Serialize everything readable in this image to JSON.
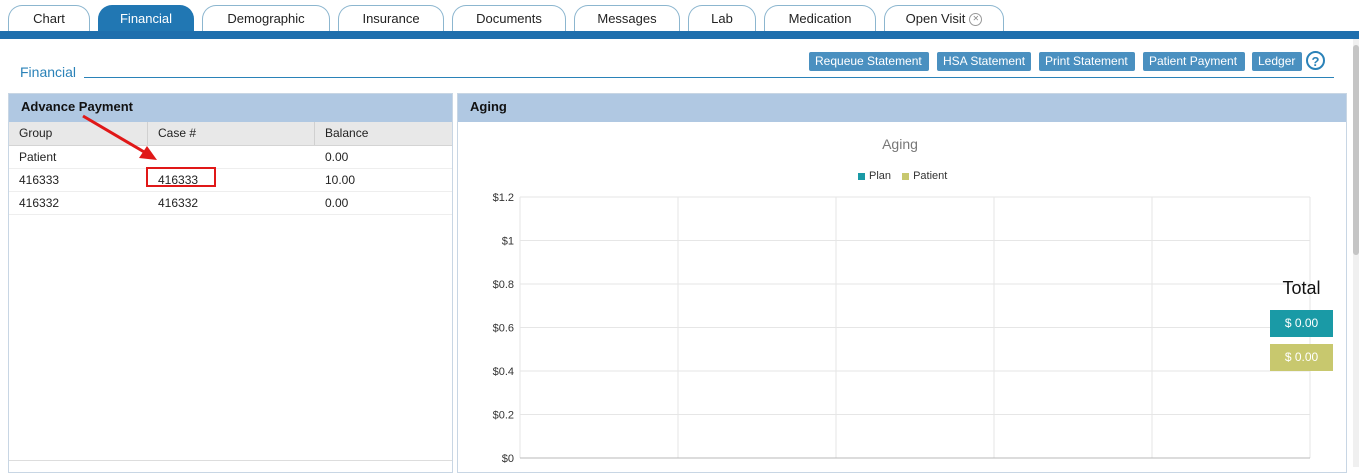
{
  "tabs": [
    {
      "label": "Chart",
      "active": false
    },
    {
      "label": "Financial",
      "active": true
    },
    {
      "label": "Demographic",
      "active": false
    },
    {
      "label": "Insurance",
      "active": false
    },
    {
      "label": "Documents",
      "active": false
    },
    {
      "label": "Messages",
      "active": false
    },
    {
      "label": "Lab",
      "active": false
    },
    {
      "label": "Medication",
      "active": false
    },
    {
      "label": "Open Visit",
      "active": false,
      "closable": true
    }
  ],
  "financial": {
    "title": "Financial",
    "buttons": [
      "Requeue Statement",
      "HSA Statement",
      "Print Statement",
      "Patient Payment",
      "Ledger"
    ],
    "help_label": "?"
  },
  "advance_payment": {
    "title": "Advance Payment",
    "columns": [
      "Group",
      "Case #",
      "Balance"
    ],
    "rows": [
      {
        "group": "Patient",
        "case": "",
        "balance": "0.00"
      },
      {
        "group": "416333",
        "case": "416333",
        "balance": "10.00"
      },
      {
        "group": "416332",
        "case": "416332",
        "balance": "0.00"
      }
    ]
  },
  "aging": {
    "title": "Aging",
    "total_label": "Total",
    "totals": [
      {
        "name": "Plan",
        "value": "$ 0.00",
        "color": "#1a9aa6"
      },
      {
        "name": "Patient",
        "value": "$ 0.00",
        "color": "#c8c86e"
      }
    ]
  },
  "chart_data": {
    "type": "bar",
    "title": "Aging",
    "series": [
      {
        "name": "Plan",
        "values": [],
        "color": "#1a9aa6"
      },
      {
        "name": "Patient",
        "values": [],
        "color": "#c8c86e"
      }
    ],
    "ylim": [
      0,
      1.2
    ],
    "y_ticks": [
      "$1.2",
      "$1",
      "$0.8",
      "$0.6",
      "$0.4",
      "$0.2",
      "$0"
    ],
    "y_tick_values": [
      1.2,
      1,
      0.8,
      0.6,
      0.4,
      0.2,
      0
    ],
    "grid": true,
    "legend": "top-center"
  },
  "icons": {
    "tab_close": "close-icon",
    "help": "help-icon",
    "annotation_arrow": "red-arrow-icon"
  }
}
